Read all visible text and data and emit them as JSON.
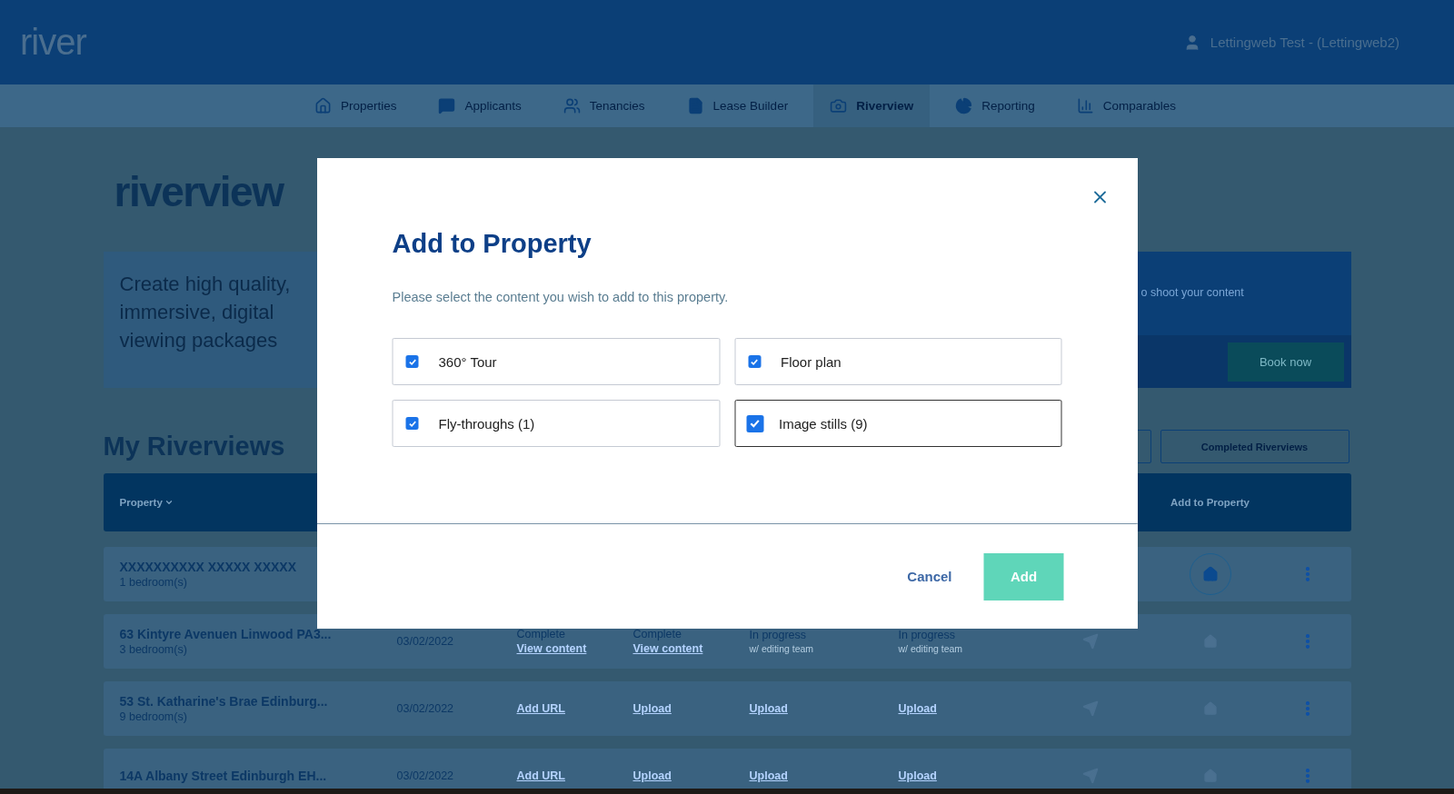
{
  "header": {
    "logo": "river",
    "user": "Lettingweb Test - (Lettingweb2)"
  },
  "nav": [
    {
      "label": "Properties",
      "selected": false
    },
    {
      "label": "Applicants",
      "selected": false
    },
    {
      "label": "Tenancies",
      "selected": false
    },
    {
      "label": "Lease Builder",
      "selected": false
    },
    {
      "label": "Riverview",
      "selected": true
    },
    {
      "label": "Reporting",
      "selected": false
    },
    {
      "label": "Comparables",
      "selected": false
    }
  ],
  "page": {
    "logo": "riverview",
    "banner": {
      "headline": "Create high quality, immersive, digital viewing packages",
      "text": "o shoot your content",
      "button": "Book now"
    },
    "heading": "My Riverviews",
    "filters": [
      {
        "selected": false
      },
      {
        "label": "Completed Riverviews",
        "selected": false
      }
    ]
  },
  "table": {
    "columns": [
      {
        "label": "Property",
        "sorted": true
      },
      {
        "label": "Add to Property",
        "sorted": false
      }
    ],
    "rows": [
      {
        "name": "XXXXXXXXXX XXXXX XXXXX",
        "bedrooms": "1 bedroom(s)",
        "date": "",
        "cells": [],
        "add_available": true
      },
      {
        "name": "63 Kintyre Avenuen Linwood PA3...",
        "bedrooms": "3 bedroom(s)",
        "date": "03/02/2022",
        "cells": [
          {
            "status": "Complete",
            "link": "View content"
          },
          {
            "status": "Complete",
            "link": "View content"
          },
          {
            "status": "In progress",
            "note": "w/ editing team"
          },
          {
            "status": "In progress",
            "note": "w/ editing team"
          }
        ],
        "add_available": false
      },
      {
        "name": "53 St. Katharine's Brae Edinburg...",
        "bedrooms": "9 bedroom(s)",
        "date": "03/02/2022",
        "cells": [
          {
            "link": "Add URL"
          },
          {
            "link": "Upload"
          },
          {
            "link": "Upload"
          },
          {
            "link": "Upload"
          }
        ],
        "add_available": false
      },
      {
        "name": "14A Albany Street Edinburgh EH...",
        "bedrooms": "",
        "date": "03/02/2022",
        "cells": [
          {
            "link": "Add URL"
          },
          {
            "link": "Upload"
          },
          {
            "link": "Upload"
          },
          {
            "link": "Upload"
          }
        ],
        "add_available": false
      }
    ]
  },
  "dialog": {
    "title": "Add to Property",
    "subtitle": "Please select the content you wish to add to this property.",
    "options": [
      {
        "label": "360° Tour",
        "checked": true,
        "focused": false
      },
      {
        "label": "Floor plan",
        "checked": true,
        "focused": false
      },
      {
        "label": "Fly-throughs (1)",
        "checked": true,
        "focused": false
      },
      {
        "label": "Image stills (9)",
        "checked": true,
        "focused": true
      }
    ],
    "cancel": "Cancel",
    "confirm": "Add"
  }
}
